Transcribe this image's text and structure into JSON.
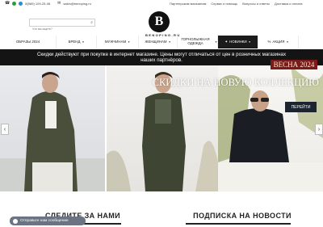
{
  "topbar": {
    "phone": "8(985) 109-25-08",
    "email": "sales@benoping.ru",
    "links": [
      "Партнерским магазинам",
      "Сервис и помощь",
      "Вопросы и ответы",
      "Доставка и оплата"
    ]
  },
  "search": {
    "placeholder": "Что вы ищете?"
  },
  "logo": {
    "letter": "B",
    "text": "BENOPING.RU"
  },
  "nav": {
    "items": [
      {
        "label": "ОБРАЗЫ 2024",
        "caret": ""
      },
      {
        "label": "БРЕНД",
        "caret": "▼"
      },
      {
        "label": "МУЖЧИНАМ",
        "caret": "▼"
      },
      {
        "label": "ЖЕНЩИНАМ",
        "caret": "▼"
      },
      {
        "label": "ГОРНОЛЫЖНАЯ ОДЕЖДА",
        "caret": "▼"
      },
      {
        "label": "НОВИНКИ",
        "caret": "▼"
      },
      {
        "label": "АКЦИЯ",
        "caret": "▼"
      }
    ]
  },
  "notice": {
    "text": "Скидки действуют при покупке в интернет магазине. Цены могут отличаться от цен в розничных магазинах наших партнёров."
  },
  "banner": {
    "spring": "ВЕСНА 2024",
    "sale": "СКИДКИ НА НОВУЮ КОЛЛЕКЦИЮ",
    "button": "ПЕРЕЙТИ",
    "prev": "‹",
    "next": "›"
  },
  "footer": {
    "follow": "СЛЕДИТЕ ЗА НАМИ",
    "subscribe": "ПОДПИСКА НА НОВОСТИ",
    "message": "Отправьте нам сообщение"
  }
}
